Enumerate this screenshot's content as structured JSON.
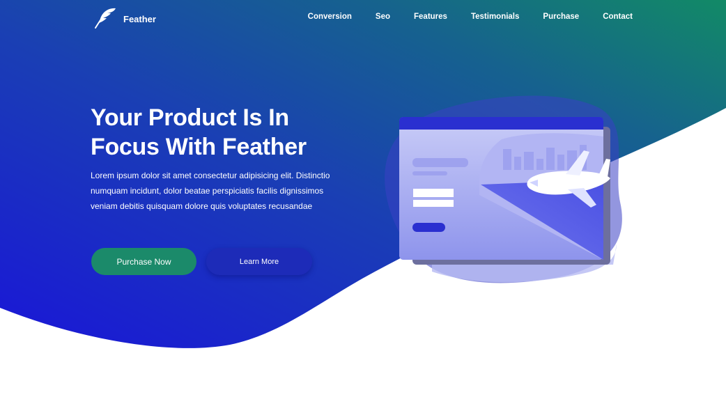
{
  "brand": {
    "name": "Feather",
    "logo_icon": "feather-icon"
  },
  "nav": {
    "items": [
      {
        "label": "Conversion"
      },
      {
        "label": "Seo"
      },
      {
        "label": "Features"
      },
      {
        "label": "Testimonials"
      },
      {
        "label": "Purchase"
      },
      {
        "label": "Contact"
      }
    ]
  },
  "hero": {
    "title_line1": "Your Product Is In",
    "title_line2": "Focus With Feather",
    "description": "Lorem ipsum dolor sit amet consectetur adipisicing elit. Distinctio numquam incidunt, dolor beatae perspiciatis facilis dignissimos veniam debitis quisquam dolore quis voluptates recusandae",
    "primary_button": "Purchase Now",
    "secondary_button": "Learn More"
  },
  "colors": {
    "gradient_start": "#1a1fd6",
    "gradient_end": "#138a6a",
    "primary_button": "#1b8a6a",
    "secondary_button": "#1d2bb8"
  },
  "illustration": {
    "icon": "browser-window-airplane-illustration"
  }
}
